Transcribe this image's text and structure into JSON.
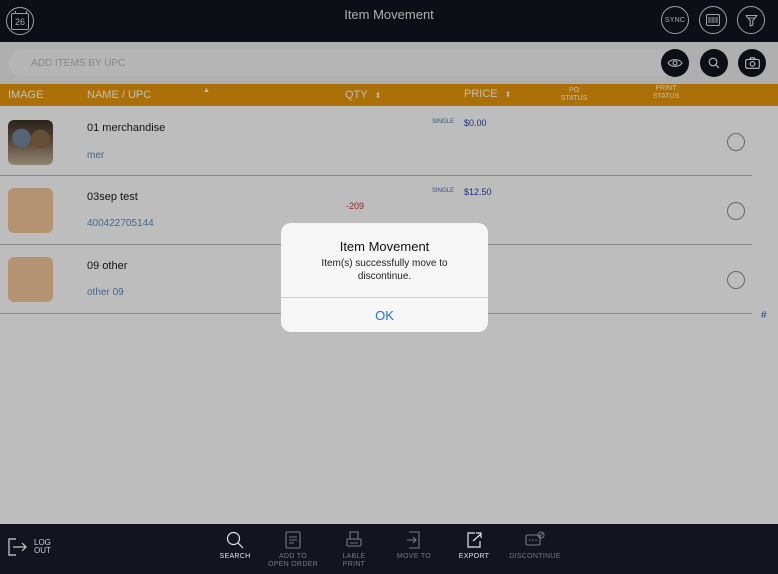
{
  "topbar": {
    "title": "Item Movement",
    "calendar_day": "26",
    "sync_label": "SYNC"
  },
  "search": {
    "placeholder": "ADD ITEMS BY UPC"
  },
  "table": {
    "columns": {
      "image": "IMAGE",
      "name": "NAME / UPC",
      "qty": "QTY",
      "price": "PRICE",
      "po_status_1": "PO",
      "po_status_2": "STATUS",
      "print_status_1": "PRINT",
      "print_status_2": "STATUS"
    },
    "rows": [
      {
        "name": "01 merchandise",
        "upc": "mer",
        "qty": "",
        "price_label": "SINGLE",
        "price": "$0.00",
        "image": "photo"
      },
      {
        "name": "03sep test",
        "upc": "400422705144",
        "qty": "-209",
        "price_label": "SINGLE",
        "price": "$12.50",
        "image": "placeholder"
      },
      {
        "name": "09 other",
        "upc": "other 09",
        "qty": "",
        "price_label": "",
        "price": "",
        "image": "placeholder"
      }
    ],
    "hash": "#"
  },
  "alert": {
    "title": "Item Movement",
    "message": "Item(s) successfully move to discontinue.",
    "ok_label": "OK"
  },
  "bottombar": {
    "logout_line1": "LOG",
    "logout_line2": "OUT",
    "tools": [
      {
        "line1": "SEARCH",
        "line2": "",
        "enabled": true,
        "icon": "search-icon"
      },
      {
        "line1": "ADD TO",
        "line2": "OPEN ORDER",
        "enabled": false,
        "icon": "clipboard-icon"
      },
      {
        "line1": "LABLE",
        "line2": "PRINT",
        "enabled": false,
        "icon": "label-print-icon"
      },
      {
        "line1": "MOVE TO",
        "line2": "",
        "enabled": false,
        "icon": "move-icon"
      },
      {
        "line1": "EXPORT",
        "line2": "",
        "enabled": true,
        "icon": "export-icon"
      },
      {
        "line1": "DISCONTINUE",
        "line2": "",
        "enabled": false,
        "icon": "discontinue-icon"
      }
    ]
  },
  "colors": {
    "dark_bar": "#141420",
    "accent_orange": "#e8980c",
    "link_blue": "#1a73e8",
    "qty_red": "#d03030"
  }
}
